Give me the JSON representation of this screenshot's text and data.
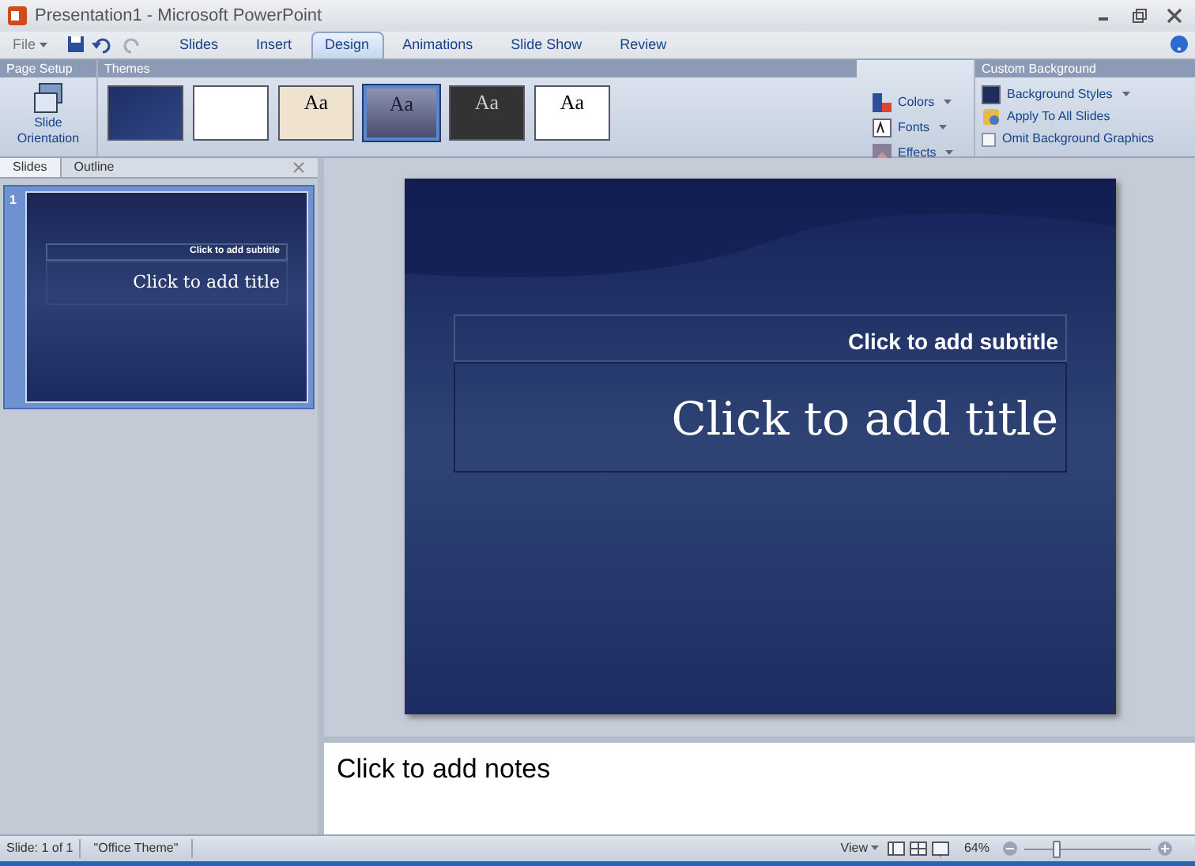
{
  "window": {
    "title": "Presentation1 - Microsoft PowerPoint"
  },
  "file_menu": "File",
  "ribbon_tabs": [
    {
      "label": "Slides",
      "selected": false
    },
    {
      "label": "Insert",
      "selected": false
    },
    {
      "label": "Design",
      "selected": true
    },
    {
      "label": "Animations",
      "selected": false
    },
    {
      "label": "Slide Show",
      "selected": false
    },
    {
      "label": "Review",
      "selected": false
    }
  ],
  "page_setup": {
    "title": "Page Setup",
    "button_lines": [
      "Slide",
      "Orientation"
    ]
  },
  "themes": {
    "title": "Themes",
    "items": [
      {
        "kind": "navy",
        "selected": false
      },
      {
        "kind": "white",
        "selected": false
      },
      {
        "kind": "parchment",
        "label": "Aa",
        "selected": false
      },
      {
        "kind": "slate",
        "label": "Aa",
        "selected": true
      },
      {
        "kind": "dark",
        "label": "Aa",
        "selected": false
      },
      {
        "kind": "wave",
        "label": "Aa",
        "selected": false
      }
    ],
    "options": [
      {
        "kind": "colors",
        "label": "Colors"
      },
      {
        "kind": "fonts",
        "label": "Fonts"
      },
      {
        "kind": "effects",
        "label": "Effects"
      }
    ]
  },
  "custom_background": {
    "title": "Custom Background",
    "background_styles": "Background Styles",
    "apply_all": "Apply To All Slides",
    "omit_graphics": {
      "label": "Omit Background Graphics",
      "checked": false
    }
  },
  "pane_tabs": [
    {
      "label": "Slides",
      "selected": true
    },
    {
      "label": "Outline",
      "selected": false
    }
  ],
  "thumbnails": [
    {
      "number": "1",
      "selected": true,
      "subtitle": "Click to add subtitle",
      "title": "Click to add title"
    }
  ],
  "slide": {
    "subtitle": "Click to add subtitle",
    "title": "Click to add title"
  },
  "notes": {
    "placeholder": "Click to add notes"
  },
  "status_bar": {
    "slide": "Slide: 1 of 1",
    "theme": "\"Office Theme\"",
    "view": "View",
    "zoom": "64%",
    "zoom_slider": {
      "level": 0.24
    }
  }
}
